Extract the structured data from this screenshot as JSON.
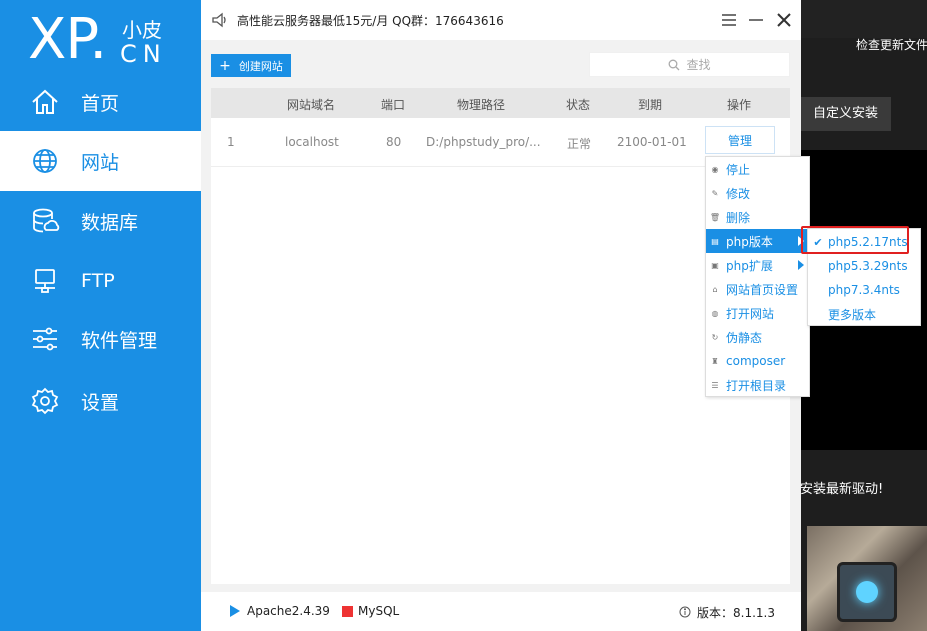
{
  "background_app": {
    "check_update_text": "检查更新文件",
    "custom_install_label": "自定义安装",
    "driver_text": "安装最新驱动!"
  },
  "logo": {
    "xp": "XP.",
    "cn_top": "小皮",
    "cn_bottom": "CN"
  },
  "sidebar": {
    "items": [
      {
        "label": "首页",
        "icon": "home-icon",
        "active": false
      },
      {
        "label": "网站",
        "icon": "globe-icon",
        "active": true
      },
      {
        "label": "数据库",
        "icon": "database-icon",
        "active": false
      },
      {
        "label": "FTP",
        "icon": "monitor-icon",
        "active": false
      },
      {
        "label": "软件管理",
        "icon": "sliders-icon",
        "active": false
      },
      {
        "label": "设置",
        "icon": "gear-icon",
        "active": false
      }
    ]
  },
  "topbar": {
    "ad_text": "高性能云服务器最低15元/月   QQ群：176643616"
  },
  "toolbar": {
    "create_label": "创建网站",
    "search_placeholder": "查找"
  },
  "table": {
    "headers": [
      "网站域名",
      "端口",
      "物理路径",
      "状态",
      "到期",
      "操作"
    ],
    "rows": [
      {
        "index": "1",
        "domain": "localhost",
        "port": "80",
        "path": "D:/phpstudy_pro/...",
        "status": "正常",
        "expiry": "2100-01-01",
        "action": "管理"
      }
    ]
  },
  "context_menu": {
    "items": [
      {
        "label": "停止",
        "icon": "stop-icon"
      },
      {
        "label": "修改",
        "icon": "edit-icon"
      },
      {
        "label": "删除",
        "icon": "delete-icon"
      },
      {
        "label": "php版本",
        "icon": "file-icon",
        "submenu": true,
        "highlighted": true
      },
      {
        "label": "php扩展",
        "icon": "extension-icon",
        "submenu": true
      },
      {
        "label": "网站首页设置",
        "icon": "home-small-icon"
      },
      {
        "label": "打开网站",
        "icon": "globe-small-icon"
      },
      {
        "label": "伪静态",
        "icon": "refresh-icon"
      },
      {
        "label": "composer",
        "icon": "composer-icon"
      },
      {
        "label": "打开根目录",
        "icon": "list-icon"
      }
    ]
  },
  "php_versions": {
    "items": [
      {
        "label": "php5.2.17nts",
        "checked": true
      },
      {
        "label": "php5.3.29nts",
        "checked": false
      },
      {
        "label": "php7.3.4nts",
        "checked": false
      },
      {
        "label": "更多版本",
        "checked": false
      }
    ]
  },
  "statusbar": {
    "apache": "Apache2.4.39",
    "mysql": "MySQL",
    "version": "版本：8.1.1.3"
  },
  "colors": {
    "accent": "#1a8fe4",
    "mysql_status": "#e33333",
    "highlight_box": "#e02020"
  }
}
